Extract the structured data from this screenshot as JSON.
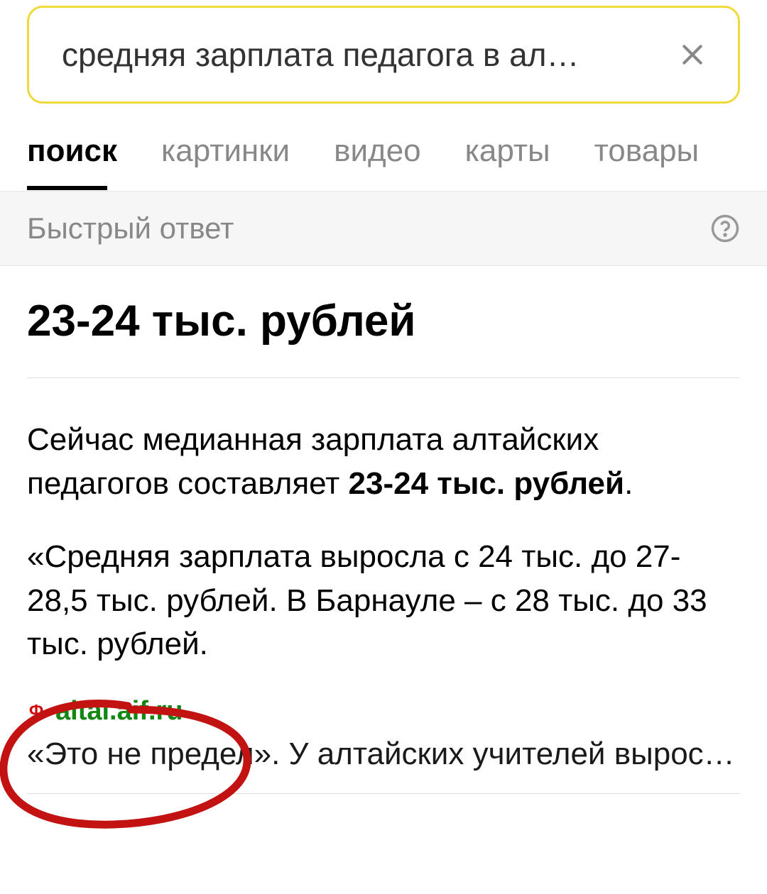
{
  "search": {
    "query": "средняя зарплата педагога в ал…"
  },
  "tabs": [
    {
      "label": "поиск",
      "active": true
    },
    {
      "label": "картинки",
      "active": false
    },
    {
      "label": "видео",
      "active": false
    },
    {
      "label": "карты",
      "active": false
    },
    {
      "label": "товары",
      "active": false
    }
  ],
  "quickAnswer": {
    "label": "Быстрый ответ",
    "headline": "23-24 тыс. рублей",
    "paragraph1_pre": "Сейчас медианная зарплата алтайских педагогов составляет ",
    "paragraph1_bold": "23-24 тыс. рублей",
    "paragraph1_post": ".",
    "paragraph2": "«Средняя зарплата выросла с 24 тыс. до 27-28,5 тыс. рублей. В Барнауле – с 28 тыс. до 33 тыс. рублей.",
    "source_domain": "altai.aif.ru",
    "source_title": "«Это не предел». У алтайских учителей вырос…"
  },
  "colors": {
    "searchBorder": "#f0d93a",
    "sourceGreen": "#138613",
    "markupRed": "#c31212"
  }
}
